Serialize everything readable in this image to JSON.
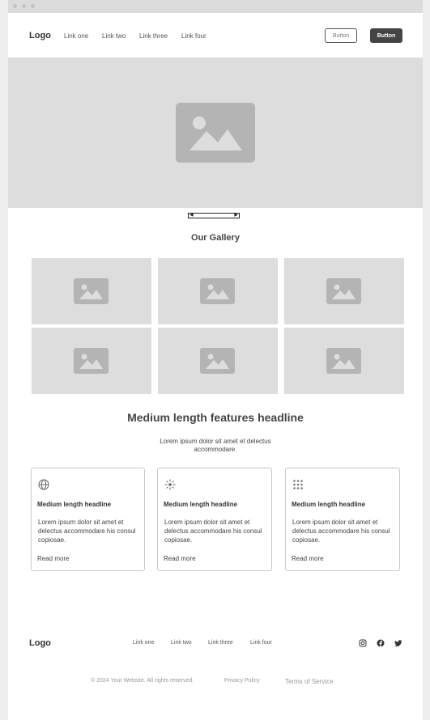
{
  "nav": {
    "logo": "Logo",
    "links": [
      "Link one",
      "Link two",
      "Link three",
      "Link four"
    ],
    "button_outline": "Button",
    "button_solid": "Button"
  },
  "gallery": {
    "title": "Our Gallery",
    "images": [
      "image-icon",
      "image-icon",
      "image-icon",
      "image-icon",
      "image-icon",
      "image-icon"
    ]
  },
  "features": {
    "title": "Medium length features headline",
    "subtitle": "Lorem ipsum dolor sit amet et delectus accommodare.",
    "cards": [
      {
        "icon": "globe-icon",
        "title": "Medium length headline",
        "body": "Lorem ipsum dolor sit amet et delectus accommodare his consul copiosae.",
        "link": "Read more"
      },
      {
        "icon": "sparkle-icon",
        "title": "Medium length headline",
        "body": "Lorem ipsum dolor sit amet et delectus accommodare his consul copiosae.",
        "link": "Read more"
      },
      {
        "icon": "grid-dots-icon",
        "title": "Medium length headline",
        "body": "Lorem ipsum dolor sit amet et delectus accommodare his consul copiosae.",
        "link": "Read more"
      }
    ]
  },
  "footer": {
    "logo": "Logo",
    "links": [
      "Link one",
      "Link two",
      "Link three",
      "Link four"
    ],
    "social": [
      "instagram-icon",
      "facebook-icon",
      "twitter-icon"
    ],
    "copyright": "© 2024 Your Website. All rights reserved.",
    "privacy": "Privacy Policy",
    "terms": "Terms of Service"
  },
  "colors": {
    "placeholder_bg": "#dddddd",
    "placeholder_icon": "#b4b4b4",
    "dark_button": "#444444"
  }
}
